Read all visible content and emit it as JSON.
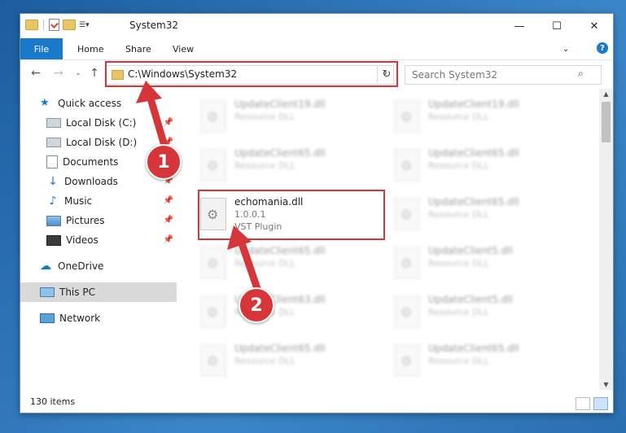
{
  "window": {
    "title": "System32",
    "controls": {
      "minimize": "—",
      "maximize": "☐",
      "close": "✕"
    }
  },
  "ribbon": {
    "file": "File",
    "tabs": [
      "Home",
      "Share",
      "View"
    ],
    "help": "?"
  },
  "nav": {
    "address": "C:\\Windows\\System32",
    "search_placeholder": "Search System32"
  },
  "sidebar": {
    "items": [
      {
        "label": "Quick access",
        "icon": "star-icon"
      },
      {
        "label": "Local Disk (C:)",
        "icon": "drive-icon",
        "pinned": true
      },
      {
        "label": "Local Disk (D:)",
        "icon": "drive-icon",
        "pinned": true
      },
      {
        "label": "Documents",
        "icon": "documents-icon",
        "pinned": true
      },
      {
        "label": "Downloads",
        "icon": "download-icon",
        "pinned": true
      },
      {
        "label": "Music",
        "icon": "music-icon",
        "pinned": true
      },
      {
        "label": "Pictures",
        "icon": "pictures-icon",
        "pinned": true
      },
      {
        "label": "Videos",
        "icon": "videos-icon",
        "pinned": true
      },
      {
        "label": "OneDrive",
        "icon": "cloud-icon"
      },
      {
        "label": "This PC",
        "icon": "computer-icon",
        "selected": true
      },
      {
        "label": "Network",
        "icon": "network-icon"
      }
    ]
  },
  "files": [
    {
      "name": "UpdateClient19.dll",
      "line2": "Resource DLL"
    },
    {
      "name": "UpdateClient19.dll",
      "line2": "Resource DLL"
    },
    {
      "name": "UpdateClient65.dll",
      "line2": "Resource DLL"
    },
    {
      "name": "UpdateClient65.dll",
      "line2": "Resource DLL"
    },
    {
      "name": "echomania.dll",
      "line2": "1.0.0.1",
      "line3": "VST Plugin"
    },
    {
      "name": "UpdateClient65.dll",
      "line2": "Resource DLL"
    },
    {
      "name": "UpdateClient65.dll",
      "line2": "Resource DLL"
    },
    {
      "name": "UpdateClient5.dll",
      "line2": "Resource DLL"
    },
    {
      "name": "UpdateClient63.dll",
      "line2": "Resource DLL"
    },
    {
      "name": "UpdateClient5.dll",
      "line2": "Resource DLL"
    },
    {
      "name": "UpdateClient65.dll",
      "line2": "Resource DLL"
    },
    {
      "name": "UpdateClient65.dll",
      "line2": "Resource DLL"
    }
  ],
  "status": {
    "count": "130 items"
  },
  "callouts": [
    "1",
    "2"
  ],
  "colors": {
    "accent": "#1979ca",
    "highlight": "#d6363a",
    "selected": "#d9d9d9"
  }
}
